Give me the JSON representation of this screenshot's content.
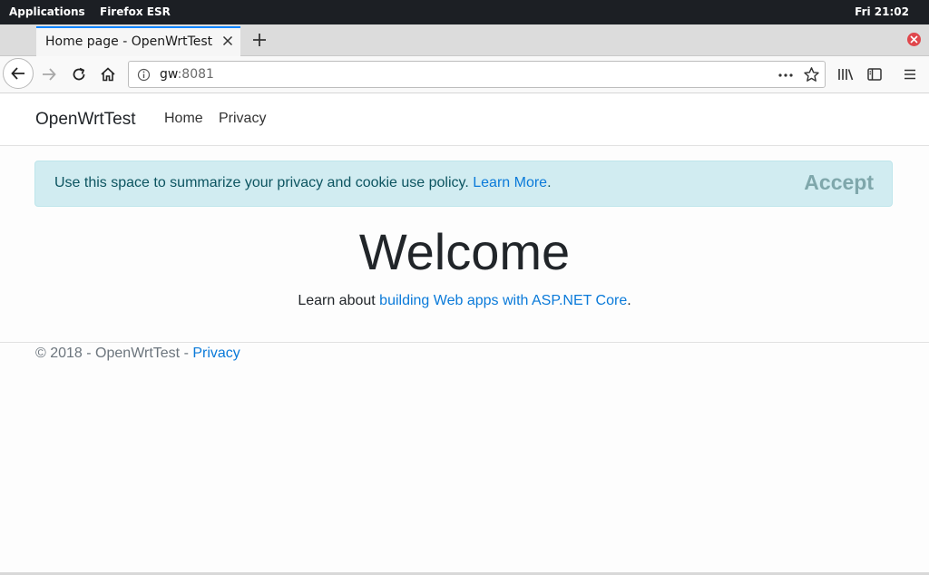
{
  "topbar": {
    "applications": "Applications",
    "app_name": "Firefox ESR",
    "clock": "Fri 21:02"
  },
  "tab": {
    "title": "Home page - OpenWrtTest"
  },
  "url": {
    "host": "gw",
    "port": ":8081"
  },
  "site": {
    "brand": "OpenWrtTest",
    "nav": [
      "Home",
      "Privacy"
    ],
    "cookie_message": "Use this space to summarize your privacy and cookie use policy.",
    "cookie_link": "Learn More",
    "cookie_period": ".",
    "accept": "Accept",
    "heading": "Welcome",
    "learn_prefix": "Learn about ",
    "learn_link": "building Web apps with ASP.NET Core",
    "learn_suffix": ".",
    "footer_text": "© 2018 - OpenWrtTest - ",
    "footer_link": "Privacy"
  },
  "icons": {
    "back": "back-arrow-icon",
    "forward": "forward-arrow-icon",
    "reload": "reload-icon",
    "home": "home-icon",
    "info": "info-icon",
    "more": "more-dots-icon",
    "star": "bookmark-star-icon",
    "library": "library-icon",
    "sidebar": "sidebar-icon",
    "menu": "hamburger-menu-icon"
  },
  "colors": {
    "accent": "#0a84ff",
    "link": "#0a7ad9",
    "alert_bg": "#d1ecf1",
    "alert_text": "#0c5460",
    "close_red": "#e0474c"
  }
}
